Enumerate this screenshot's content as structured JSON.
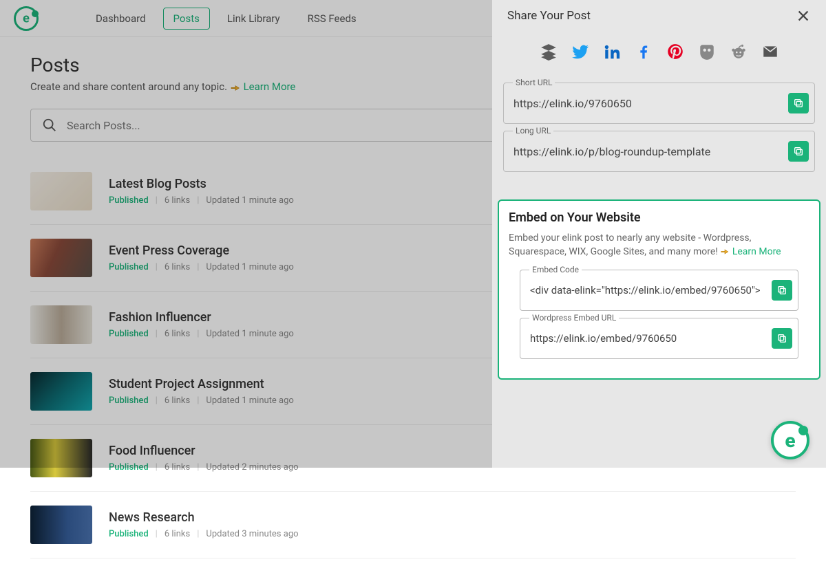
{
  "nav": {
    "items": [
      {
        "label": "Dashboard",
        "active": false
      },
      {
        "label": "Posts",
        "active": true
      },
      {
        "label": "Link Library",
        "active": false
      },
      {
        "label": "RSS Feeds",
        "active": false
      }
    ]
  },
  "page": {
    "title": "Posts",
    "subtitle_before": "Create and share content around any topic. ",
    "learn_more": "Learn More"
  },
  "search": {
    "placeholder": "Search Posts..."
  },
  "posts": [
    {
      "title": "Latest Blog Posts",
      "status": "Published",
      "links": "6 links",
      "updated": "Updated 1 minute ago",
      "thumb": "linear-gradient(135deg,#f5f0e8 0%,#e8dcc8 100%)"
    },
    {
      "title": "Event Press Coverage",
      "status": "Published",
      "links": "6 links",
      "updated": "Updated 1 minute ago",
      "thumb": "linear-gradient(115deg,#c97b5a 0%, #8a4a3a 40%, #5a5048 100%)"
    },
    {
      "title": "Fashion Influencer",
      "status": "Published",
      "links": "6 links",
      "updated": "Updated 1 minute ago",
      "thumb": "linear-gradient(90deg,#ecebe6 0%, #b8aa98 50%, #e6e3da 100%)"
    },
    {
      "title": "Student Project Assignment",
      "status": "Published",
      "links": "6 links",
      "updated": "Updated 1 minute ago",
      "thumb": "linear-gradient(135deg,#0a2a30 0%, #0e6d74 50%, #13a7af 100%)"
    },
    {
      "title": "Food Influencer",
      "status": "Published",
      "links": "6 links",
      "updated": "Updated 2 minutes ago",
      "thumb": "linear-gradient(90deg,#4a5a16 0%, #d7c83d 40%, #2a2a2a 100%)"
    },
    {
      "title": "News Research",
      "status": "Published",
      "links": "6 links",
      "updated": "Updated 3 minutes ago",
      "thumb": "linear-gradient(90deg,#0a1a2a 0%, #2a4a7a 60%, #3a5a8a 100%)"
    }
  ],
  "panel": {
    "title": "Share Your Post",
    "short_url": {
      "label": "Short URL",
      "value": "https://elink.io/9760650"
    },
    "long_url": {
      "label": "Long URL",
      "value": "https://elink.io/p/blog-roundup-template"
    },
    "embed": {
      "title": "Embed on Your Website",
      "desc_before": "Embed your elink post to nearly any website - Wordpress, Squarespace, WIX, Google Sites, and many more! ",
      "learn_more": "Learn More",
      "code": {
        "label": "Embed Code",
        "value": "<div data-elink=\"https://elink.io/embed/9760650\">"
      },
      "wpurl": {
        "label": "Wordpress Embed URL",
        "value": "https://elink.io/embed/9760650"
      }
    }
  },
  "social_icons": [
    "buffer",
    "twitter",
    "linkedin",
    "facebook",
    "pinterest",
    "hootsuite",
    "reddit",
    "email"
  ]
}
